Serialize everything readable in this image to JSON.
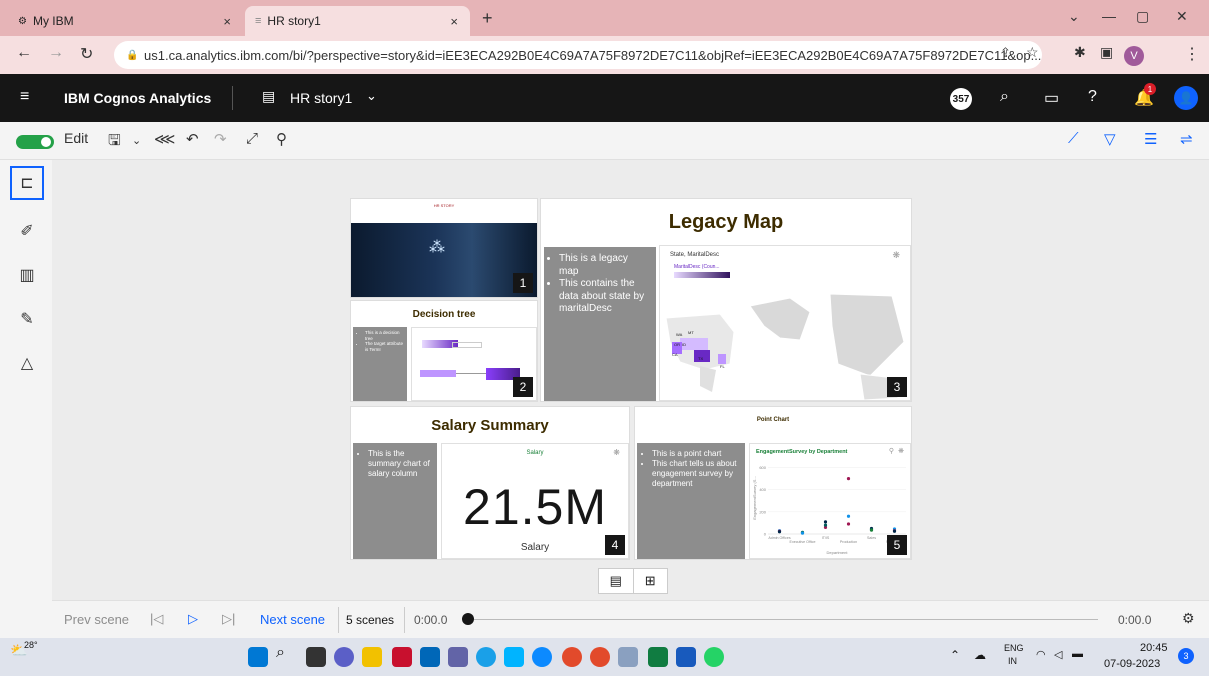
{
  "browser": {
    "tabs": [
      {
        "title": "My IBM",
        "close": "×"
      },
      {
        "title": "HR story1",
        "close": "×"
      }
    ],
    "new_tab": "+",
    "url": "us1.ca.analytics.ibm.com/bi/?perspective=story&id=iEE3ECA292B0E4C69A7A75F8972DE7C11&objRef=iEE3ECA292B0E4C69A7A75F8972DE7C11&op...",
    "profile_initial": "V"
  },
  "app": {
    "brand": "IBM Cognos Analytics",
    "story_title": "HR story1",
    "notification_count_badge": "357",
    "alert_count": "1"
  },
  "toolbar": {
    "edit_label": "Edit"
  },
  "scenes": {
    "s1": {
      "header": "HR STORY",
      "number": "1"
    },
    "s2": {
      "title": "Decision tree",
      "number": "2",
      "note": [
        "This is a decision tree",
        "The target attribute is TermI"
      ]
    },
    "s3": {
      "title": "Legacy Map",
      "number": "3",
      "note": [
        "This is a legacy map",
        "This contains the data about state by maritalDesc"
      ],
      "map_title": "State, MaritalDesc",
      "legend_title": "MaritalDesc (Coun...",
      "state_labels": [
        "WA",
        "MT",
        "OR",
        "ID",
        "CA",
        "TX",
        "FL"
      ]
    },
    "s4": {
      "title": "Salary Summary",
      "number": "4",
      "note": [
        "This is the summary chart of salary column"
      ],
      "kpi_label": "Salary",
      "kpi_value": "21.5M",
      "kpi_caption": "Salary"
    },
    "s5": {
      "title": "Point Chart",
      "number": "5",
      "note": [
        "This is a point chart",
        "This chart tells us about engagement survey by department"
      ]
    }
  },
  "chart_data": {
    "type": "scatter",
    "title": "EngagementSurvey by Department",
    "xlabel": "Department",
    "ylabel": "EngagementSurvey (S...",
    "categories": [
      "Admin Offices",
      "Executive Office",
      "IT/IS",
      "Production",
      "Sales",
      "Software..."
    ],
    "yticks": [
      0,
      200,
      400,
      600
    ],
    "ylim": [
      0,
      650
    ],
    "colors": [
      "#1192e8",
      "#005d5d",
      "#9f1853",
      "#198038",
      "#012749"
    ],
    "series": [
      {
        "values": [
          30,
          15,
          60,
          500,
          50,
          45
        ]
      },
      {
        "values": [
          25,
          10,
          110,
          160,
          40,
          30
        ]
      },
      {
        "values": [
          20,
          8,
          80,
          90,
          35,
          25
        ]
      }
    ]
  },
  "timeline": {
    "prev": "Prev scene",
    "next": "Next scene",
    "scenes_count": "5 scenes",
    "time_start": "0:00.0",
    "time_end": "0:00.0"
  },
  "taskbar": {
    "temperature": "28°",
    "lang": "ENG",
    "region": "IN",
    "time": "20:45",
    "date": "07-09-2023",
    "notif": "3"
  }
}
